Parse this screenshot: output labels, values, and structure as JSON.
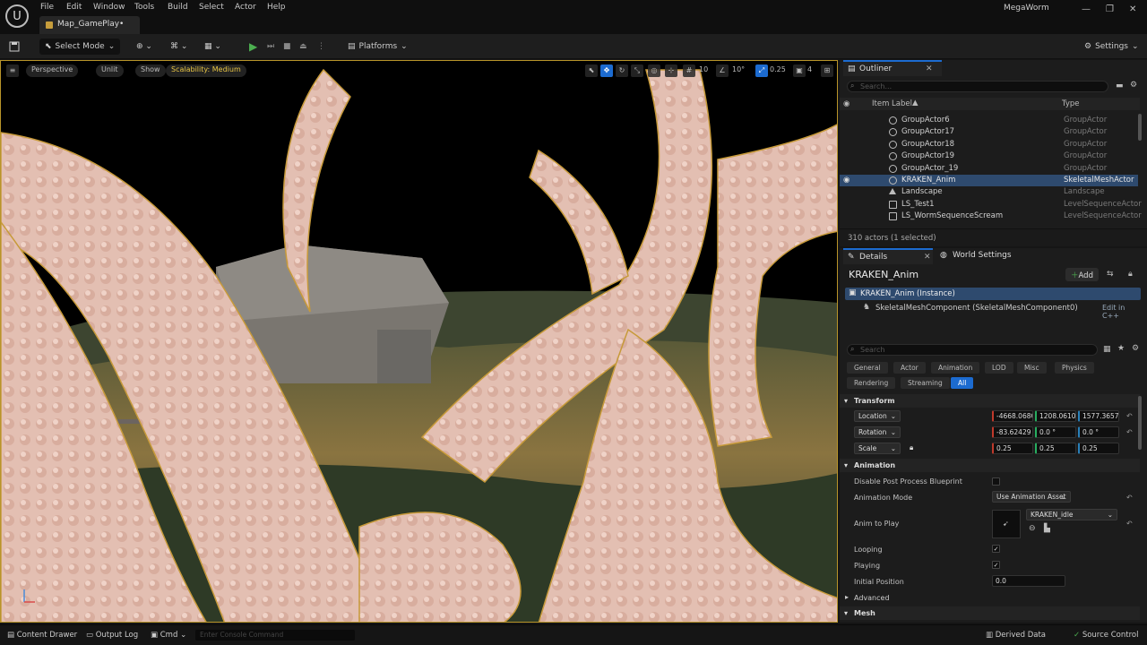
{
  "app": {
    "logo_icon": "unreal-logo-icon",
    "menu": [
      "File",
      "Edit",
      "Window",
      "Tools",
      "Build",
      "Select",
      "Actor",
      "Help"
    ],
    "doc_tab": "Map_GamePlay•",
    "project_name": "MegaWorm",
    "window_controls": [
      "—",
      "❐",
      "✕"
    ]
  },
  "toolbar": {
    "select_mode": "Select Mode",
    "platforms": "Platforms",
    "settings": "Settings"
  },
  "viewport": {
    "perspective": "Perspective",
    "lit": "Unlit",
    "show": "Show",
    "scalability": "Scalability: Medium",
    "grid_snap": "10",
    "rot_snap": "10°",
    "scale_snap": "0.25",
    "camera_speed": "4"
  },
  "outliner": {
    "tab": "Outliner",
    "search_placeholder": "Search...",
    "col_label": "Item Label",
    "col_type": "Type",
    "rows": [
      {
        "label": "GroupActor6",
        "type": "GroupActor"
      },
      {
        "label": "GroupActor17",
        "type": "GroupActor"
      },
      {
        "label": "GroupActor18",
        "type": "GroupActor"
      },
      {
        "label": "GroupActor19",
        "type": "GroupActor"
      },
      {
        "label": "GroupActor_19",
        "type": "GroupActor"
      },
      {
        "label": "KRAKEN_Anim",
        "type": "SkeletalMeshActor"
      },
      {
        "label": "Landscape",
        "type": "Landscape"
      },
      {
        "label": "LS_Test1",
        "type": "LevelSequenceActor"
      },
      {
        "label": "LS_WormSequenceScream",
        "type": "LevelSequenceActor"
      }
    ],
    "count": "310 actors (1 selected)"
  },
  "details": {
    "tab": "Details",
    "tab2": "World Settings",
    "actor_name": "KRAKEN_Anim",
    "add_label": "Add",
    "instance": "KRAKEN_Anim (Instance)",
    "component": "SkeletalMeshComponent (SkeletalMeshComponent0)",
    "edit_link": "Edit in C++",
    "search_placeholder": "Search",
    "categories": [
      "General",
      "Actor",
      "Animation",
      "LOD",
      "Misc",
      "Physics",
      "Rendering",
      "Streaming",
      "All"
    ],
    "transform": {
      "section": "Transform",
      "location_label": "Location",
      "location": [
        "-4668.068C",
        "1208.06101",
        "1577.3657"
      ],
      "rotation_label": "Rotation",
      "rotation": [
        "-83.62429",
        "0.0 °",
        "0.0 °"
      ],
      "scale_label": "Scale",
      "scale": [
        "0.25",
        "0.25",
        "0.25"
      ]
    },
    "animation": {
      "section": "Animation",
      "disable_pp": "Disable Post Process Blueprint",
      "mode_label": "Animation Mode",
      "mode_value": "Use Animation Asset",
      "anim_label": "Anim to Play",
      "anim_value": "KRAKEN_idle",
      "looping": "Looping",
      "playing": "Playing",
      "initial_label": "Initial Position",
      "initial_value": "0.0"
    },
    "advanced": "Advanced",
    "mesh_section": "Mesh"
  },
  "statusbar": {
    "content_drawer": "Content Drawer",
    "output_log": "Output Log",
    "cmd": "Cmd",
    "console_placeholder": "Enter Console Command",
    "derived_data": "Derived Data",
    "source_control": "Source Control"
  }
}
